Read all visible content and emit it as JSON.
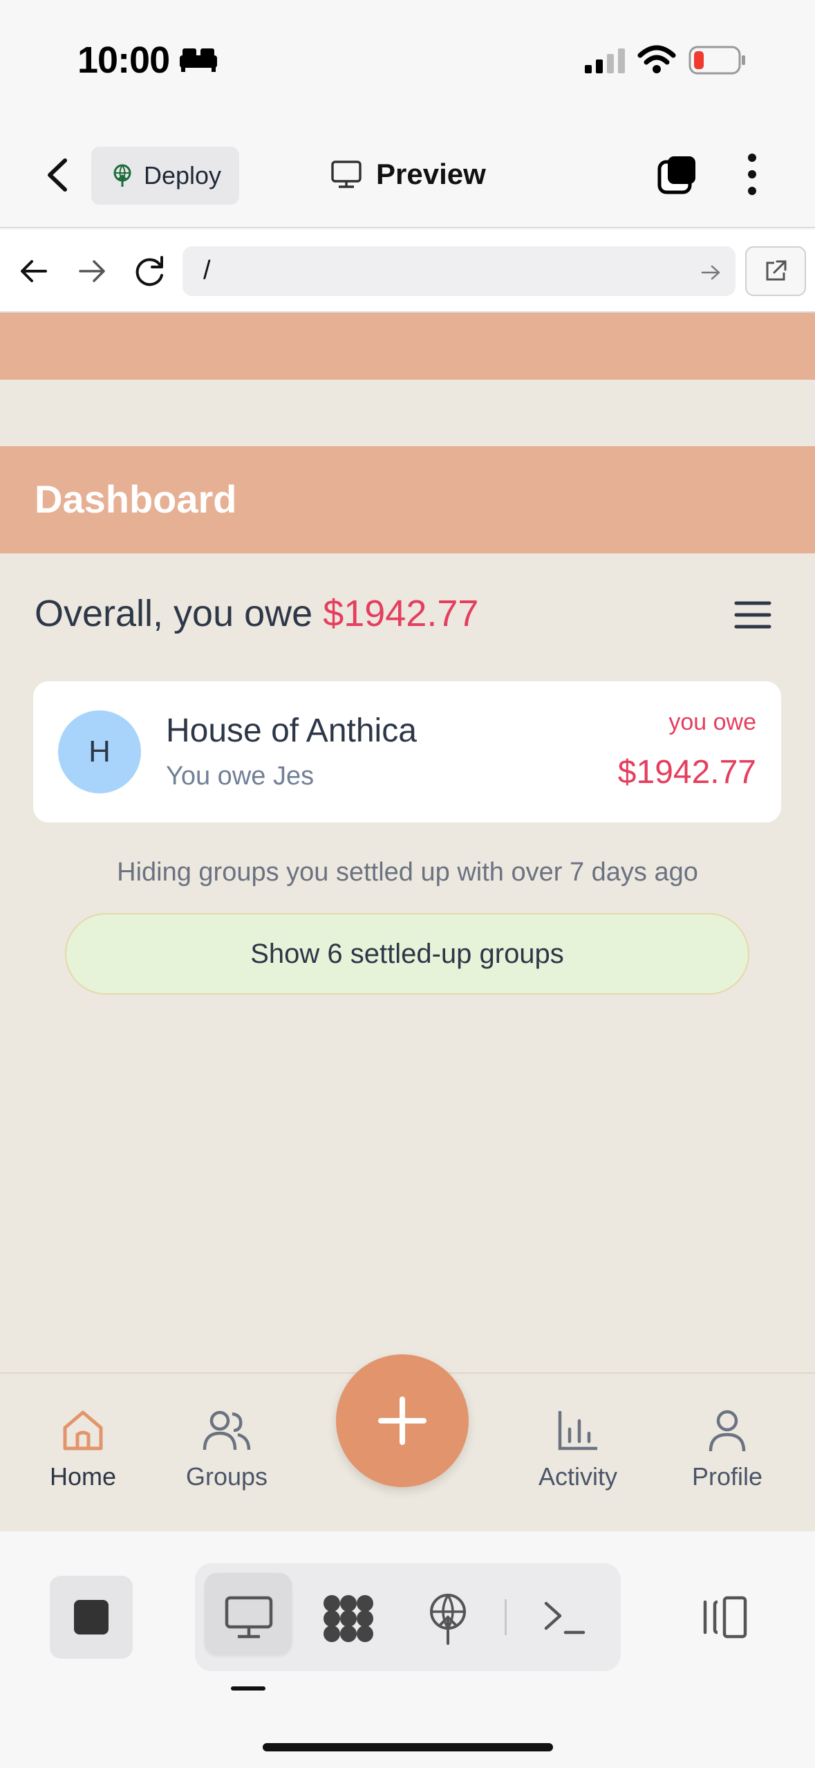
{
  "status_bar": {
    "time": "10:00"
  },
  "app_header": {
    "deploy_label": "Deploy",
    "preview_label": "Preview"
  },
  "browser": {
    "url": "/"
  },
  "page": {
    "title": "Dashboard",
    "overall_prefix": "Overall, you owe",
    "overall_amount": "$1942.77",
    "groups": [
      {
        "initial": "H",
        "name": "House of Anthica",
        "subtitle": "You owe Jes",
        "status": "you owe",
        "amount": "$1942.77"
      }
    ],
    "hiding_note": "Hiding groups you settled up with over 7 days ago",
    "show_settled_label": "Show 6 settled-up groups"
  },
  "tabbar": {
    "home": "Home",
    "groups": "Groups",
    "activity": "Activity",
    "profile": "Profile"
  },
  "colors": {
    "accent": "#e2956c",
    "banner": "#e6b095",
    "owe_red": "#e53e5e",
    "background": "#ece8df"
  }
}
